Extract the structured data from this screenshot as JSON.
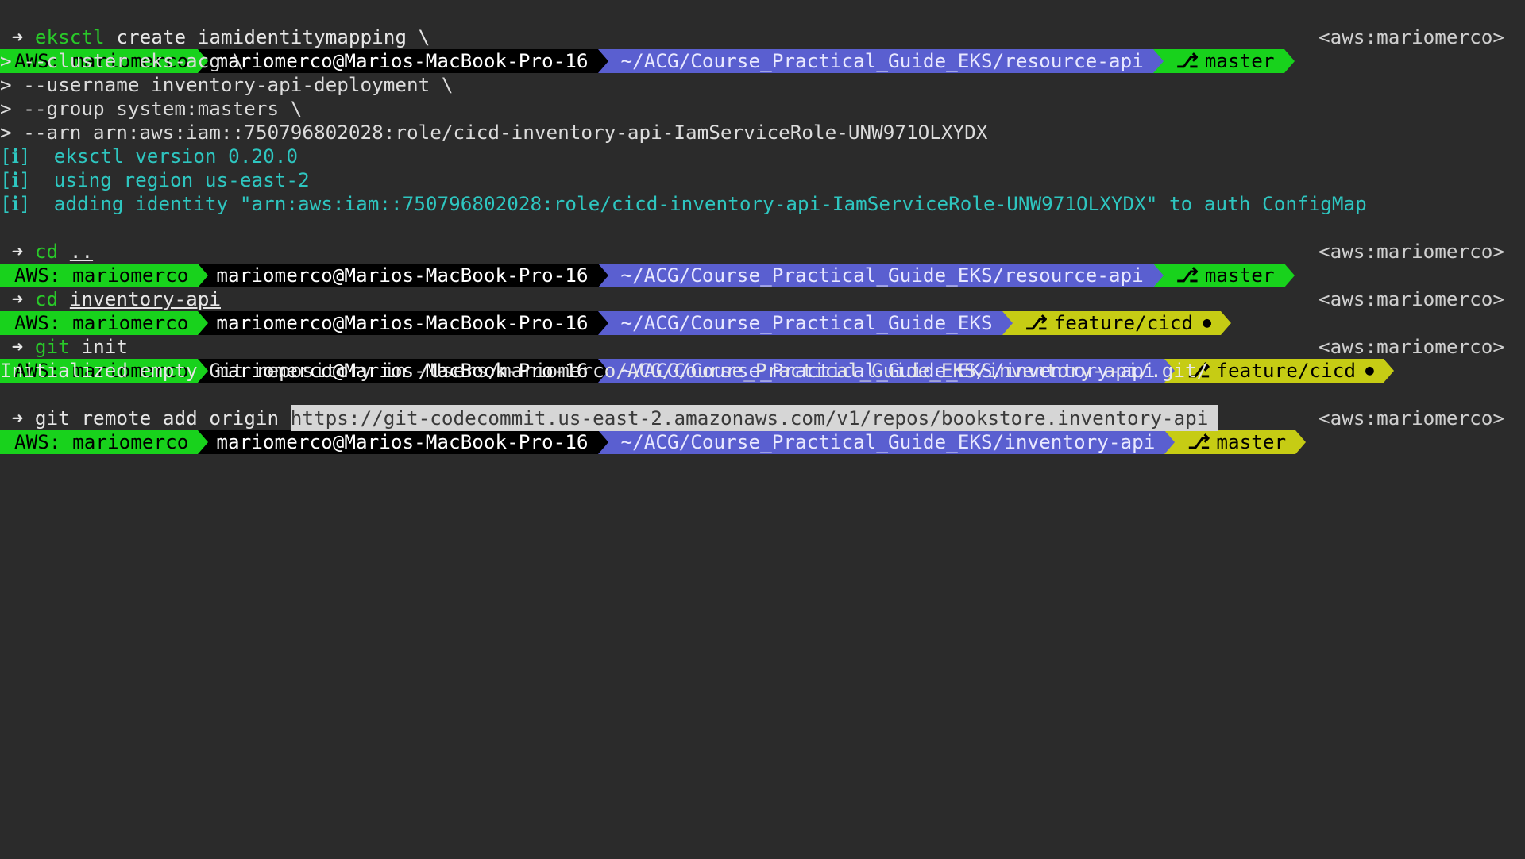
{
  "prompt": {
    "aws": "AWS: mariomerco",
    "host": "mariomerco@Marios-MacBook-Pro-16",
    "rprompt": "<aws:mariomerco>",
    "arrow": "➜",
    "branch_icon": "⎇",
    "dirty_icon": "●"
  },
  "colors": {
    "background": "#2b2b2b",
    "aws_segment": "#18d21c",
    "dir_segment": "#5a5fd0",
    "git_dirty_segment": "#c6cc14",
    "info_text": "#2ec6c0"
  },
  "lines": {
    "p1": {
      "dir": "~/ACG/Course_Practical_Guide_EKS/resource-api",
      "branch": "master"
    },
    "c1": {
      "cmd": "eksctl",
      "args": " create iamidentitymapping \\"
    },
    "k1": "> --cluster eks-acg \\",
    "k2": "> --username inventory-api-deployment \\",
    "k3": "> --group system:masters \\",
    "k4": "> --arn arn:aws:iam::750796802028:role/cicd-inventory-api-IamServiceRole-UNW971OLXYDX",
    "i_tag": "[ℹ]",
    "i1": "eksctl version 0.20.0",
    "i2": "using region us-east-2",
    "i3": "adding identity \"arn:aws:iam::750796802028:role/cicd-inventory-api-IamServiceRole-UNW971OLXYDX\" to auth ConfigMap",
    "p2": {
      "dir": "~/ACG/Course_Practical_Guide_EKS/resource-api",
      "branch": "master"
    },
    "c2": {
      "cmd": "cd",
      "arg": ".."
    },
    "p3": {
      "dir": "~/ACG/Course_Practical_Guide_EKS",
      "branch": "feature/cicd"
    },
    "c3": {
      "cmd": "cd",
      "arg": "inventory-api"
    },
    "p4": {
      "dir": "~/ACG/Course_Practical_Guide_EKS/inventory-api",
      "branch": "feature/cicd"
    },
    "c4": {
      "cmd": "git",
      "args": " init"
    },
    "o4": "Initialized empty Git repository in /Users/mariomerco/ACG/Course_Practical_Guide_EKS/inventory-api/.git/",
    "p5": {
      "dir": "~/ACG/Course_Practical_Guide_EKS/inventory-api",
      "branch": "master"
    },
    "c5": {
      "cmd": "git remote add origin",
      "arg": "https://git-codecommit.us-east-2.amazonaws.com/v1/repos/bookstore.inventory-api"
    }
  }
}
